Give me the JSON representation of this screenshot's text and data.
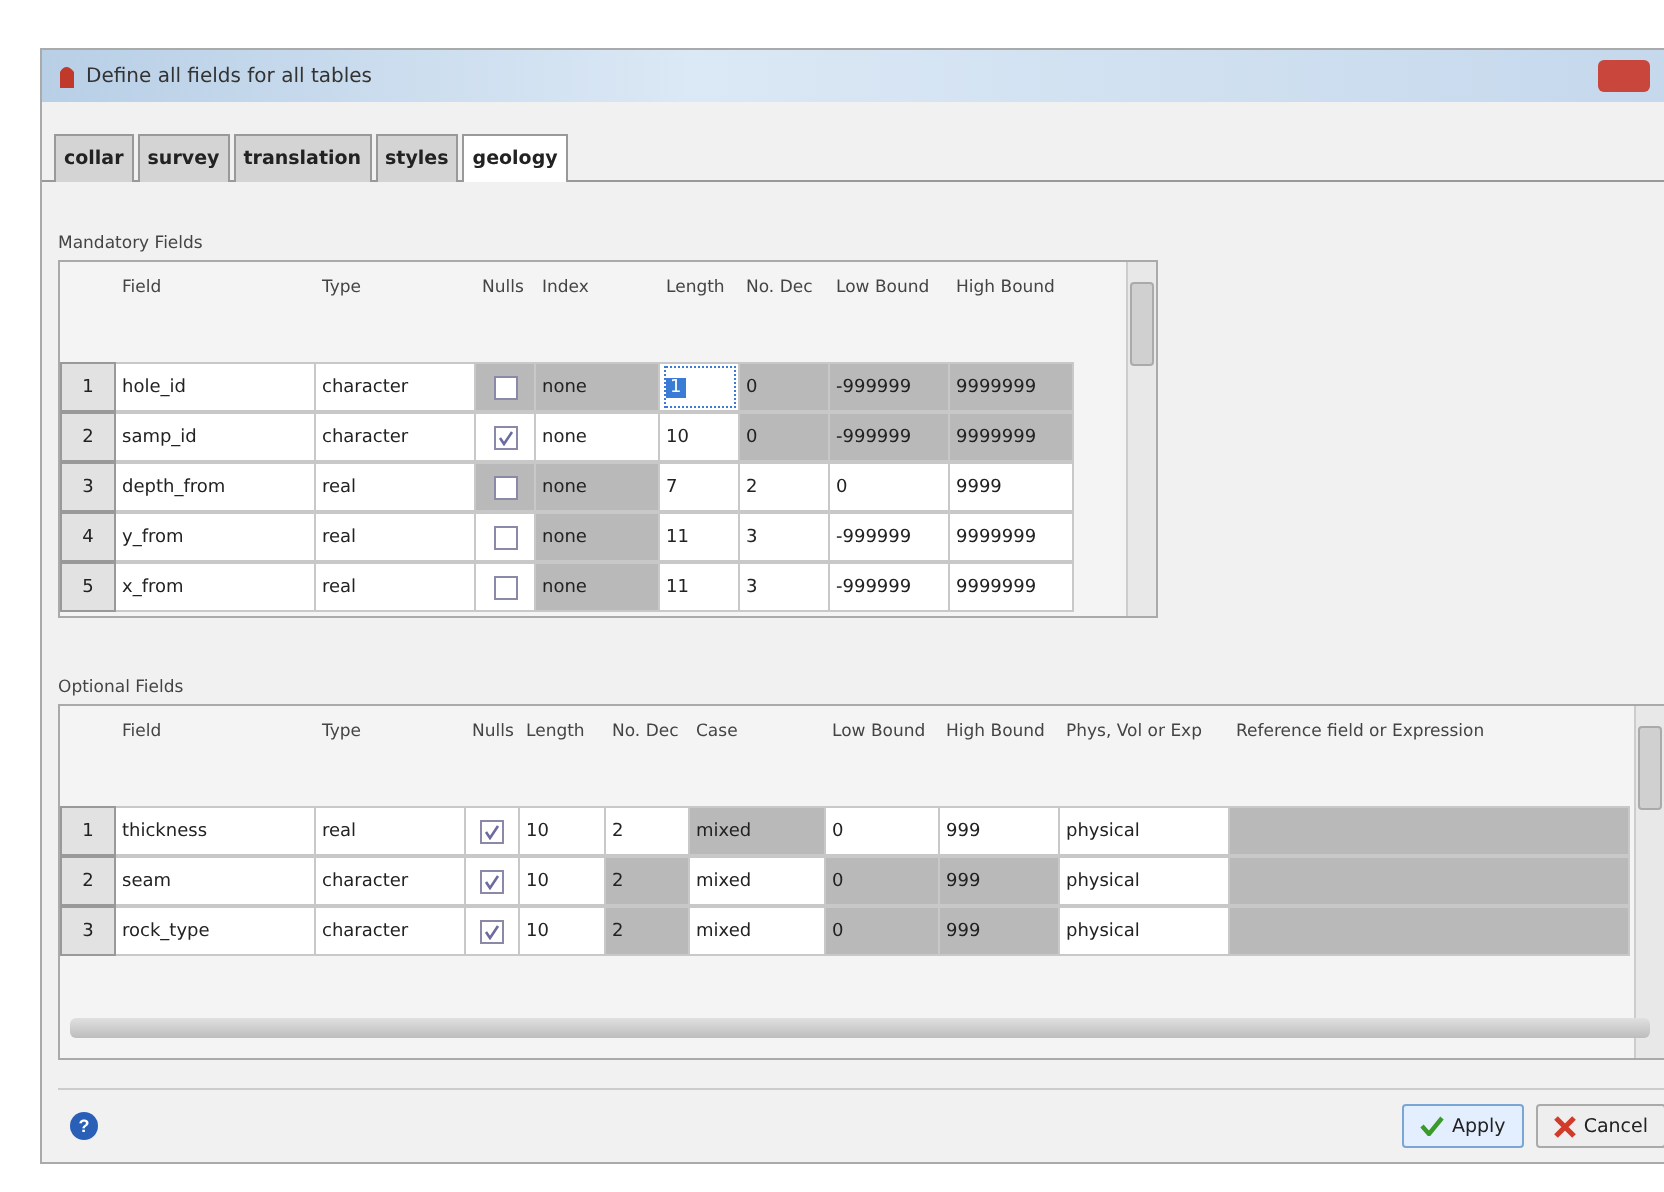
{
  "window": {
    "title": "Define all fields for all tables"
  },
  "tabs": [
    {
      "label": "collar",
      "selected": false
    },
    {
      "label": "survey",
      "selected": false
    },
    {
      "label": "translation",
      "selected": false
    },
    {
      "label": "styles",
      "selected": false
    },
    {
      "label": "geology",
      "selected": true
    }
  ],
  "mandatory": {
    "title": "Mandatory Fields",
    "columns": [
      "Field",
      "Type",
      "Nulls",
      "Index",
      "Length",
      "No. Dec",
      "Low Bound",
      "High Bound"
    ],
    "rows": [
      {
        "number": "1",
        "cells": [
          {
            "kind": "text",
            "text": "hole_id",
            "shaded": false,
            "focused": false
          },
          {
            "kind": "text",
            "text": "character",
            "shaded": false,
            "focused": false
          },
          {
            "kind": "check",
            "checked": false,
            "shaded": true,
            "focused": false
          },
          {
            "kind": "text",
            "text": "none",
            "shaded": true,
            "focused": false
          },
          {
            "kind": "text",
            "text": "1",
            "shaded": false,
            "focused": true
          },
          {
            "kind": "text",
            "text": "0",
            "shaded": true,
            "focused": false
          },
          {
            "kind": "text",
            "text": "-999999",
            "shaded": true,
            "focused": false
          },
          {
            "kind": "text",
            "text": "9999999",
            "shaded": true,
            "focused": false
          }
        ]
      },
      {
        "number": "2",
        "cells": [
          {
            "kind": "text",
            "text": "samp_id",
            "shaded": false,
            "focused": false
          },
          {
            "kind": "text",
            "text": "character",
            "shaded": false,
            "focused": false
          },
          {
            "kind": "check",
            "checked": true,
            "shaded": false,
            "focused": false
          },
          {
            "kind": "text",
            "text": "none",
            "shaded": false,
            "focused": false
          },
          {
            "kind": "text",
            "text": "10",
            "shaded": false,
            "focused": false
          },
          {
            "kind": "text",
            "text": "0",
            "shaded": true,
            "focused": false
          },
          {
            "kind": "text",
            "text": "-999999",
            "shaded": true,
            "focused": false
          },
          {
            "kind": "text",
            "text": "9999999",
            "shaded": true,
            "focused": false
          }
        ]
      },
      {
        "number": "3",
        "cells": [
          {
            "kind": "text",
            "text": "depth_from",
            "shaded": false,
            "focused": false
          },
          {
            "kind": "text",
            "text": "real",
            "shaded": false,
            "focused": false
          },
          {
            "kind": "check",
            "checked": false,
            "shaded": true,
            "focused": false
          },
          {
            "kind": "text",
            "text": "none",
            "shaded": true,
            "focused": false
          },
          {
            "kind": "text",
            "text": "7",
            "shaded": false,
            "focused": false
          },
          {
            "kind": "text",
            "text": "2",
            "shaded": false,
            "focused": false
          },
          {
            "kind": "text",
            "text": "0",
            "shaded": false,
            "focused": false
          },
          {
            "kind": "text",
            "text": "9999",
            "shaded": false,
            "focused": false
          }
        ]
      },
      {
        "number": "4",
        "cells": [
          {
            "kind": "text",
            "text": "y_from",
            "shaded": false,
            "focused": false
          },
          {
            "kind": "text",
            "text": "real",
            "shaded": false,
            "focused": false
          },
          {
            "kind": "check",
            "checked": false,
            "shaded": false,
            "focused": false
          },
          {
            "kind": "text",
            "text": "none",
            "shaded": true,
            "focused": false
          },
          {
            "kind": "text",
            "text": "11",
            "shaded": false,
            "focused": false
          },
          {
            "kind": "text",
            "text": "3",
            "shaded": false,
            "focused": false
          },
          {
            "kind": "text",
            "text": "-999999",
            "shaded": false,
            "focused": false
          },
          {
            "kind": "text",
            "text": "9999999",
            "shaded": false,
            "focused": false
          }
        ]
      },
      {
        "number": "5",
        "cells": [
          {
            "kind": "text",
            "text": "x_from",
            "shaded": false,
            "focused": false
          },
          {
            "kind": "text",
            "text": "real",
            "shaded": false,
            "focused": false
          },
          {
            "kind": "check",
            "checked": false,
            "shaded": false,
            "focused": false
          },
          {
            "kind": "text",
            "text": "none",
            "shaded": true,
            "focused": false
          },
          {
            "kind": "text",
            "text": "11",
            "shaded": false,
            "focused": false
          },
          {
            "kind": "text",
            "text": "3",
            "shaded": false,
            "focused": false
          },
          {
            "kind": "text",
            "text": "-999999",
            "shaded": false,
            "focused": false
          },
          {
            "kind": "text",
            "text": "9999999",
            "shaded": false,
            "focused": false
          }
        ]
      }
    ]
  },
  "optional": {
    "title": "Optional Fields",
    "columns": [
      "Field",
      "Type",
      "Nulls",
      "Length",
      "No. Dec",
      "Case",
      "Low Bound",
      "High Bound",
      "Phys, Vol or Exp",
      "Reference field or Expression"
    ],
    "rows": [
      {
        "number": "1",
        "cells": [
          {
            "kind": "text",
            "text": "thickness",
            "shaded": false
          },
          {
            "kind": "text",
            "text": "real",
            "shaded": false
          },
          {
            "kind": "check",
            "checked": true,
            "shaded": false
          },
          {
            "kind": "text",
            "text": "10",
            "shaded": false
          },
          {
            "kind": "text",
            "text": "2",
            "shaded": false
          },
          {
            "kind": "text",
            "text": "mixed",
            "shaded": true
          },
          {
            "kind": "text",
            "text": "0",
            "shaded": false
          },
          {
            "kind": "text",
            "text": "999",
            "shaded": false
          },
          {
            "kind": "text",
            "text": "physical",
            "shaded": false
          },
          {
            "kind": "blank",
            "shaded": true
          }
        ]
      },
      {
        "number": "2",
        "cells": [
          {
            "kind": "text",
            "text": "seam",
            "shaded": false
          },
          {
            "kind": "text",
            "text": "character",
            "shaded": false
          },
          {
            "kind": "check",
            "checked": true,
            "shaded": false
          },
          {
            "kind": "text",
            "text": "10",
            "shaded": false
          },
          {
            "kind": "text",
            "text": "2",
            "shaded": true
          },
          {
            "kind": "text",
            "text": "mixed",
            "shaded": false
          },
          {
            "kind": "text",
            "text": "0",
            "shaded": true
          },
          {
            "kind": "text",
            "text": "999",
            "shaded": true
          },
          {
            "kind": "text",
            "text": "physical",
            "shaded": false
          },
          {
            "kind": "blank",
            "shaded": true
          }
        ]
      },
      {
        "number": "3",
        "cells": [
          {
            "kind": "text",
            "text": "rock_type",
            "shaded": false
          },
          {
            "kind": "text",
            "text": "character",
            "shaded": false
          },
          {
            "kind": "check",
            "checked": true,
            "shaded": false
          },
          {
            "kind": "text",
            "text": "10",
            "shaded": false
          },
          {
            "kind": "text",
            "text": "2",
            "shaded": true
          },
          {
            "kind": "text",
            "text": "mixed",
            "shaded": false
          },
          {
            "kind": "text",
            "text": "0",
            "shaded": true
          },
          {
            "kind": "text",
            "text": "999",
            "shaded": true
          },
          {
            "kind": "text",
            "text": "physical",
            "shaded": false
          },
          {
            "kind": "blank",
            "shaded": true
          }
        ]
      }
    ]
  },
  "help": {
    "label": "?"
  },
  "buttons": [
    {
      "kind": "apply",
      "label": "Apply"
    },
    {
      "kind": "cancel",
      "label": "Cancel"
    }
  ]
}
